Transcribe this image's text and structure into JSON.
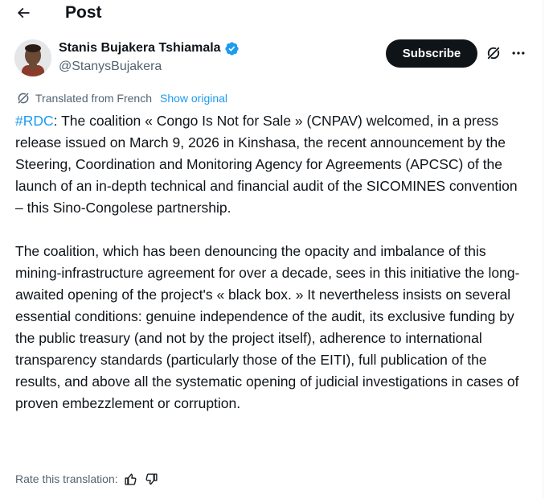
{
  "header": {
    "title": "Post"
  },
  "author": {
    "name": "Stanis Bujakera Tshiamala",
    "handle": "@StanysBujakera",
    "verified": true
  },
  "actions": {
    "subscribe_label": "Subscribe"
  },
  "translation": {
    "label": "Translated from French",
    "show_original": "Show original"
  },
  "post": {
    "hashtag": "#RDC",
    "paragraph1_text": ": The coalition « Congo Is Not for Sale » (CNPAV) welcomed, in a press release issued on March 9, 2026 in Kinshasa, the recent announcement by the Steering, Coordination and Monitoring Agency for Agreements (APCSC) of the launch of an in-depth technical and financial audit of the SICOMINES convention – this Sino-Congolese partnership.",
    "paragraph2": "The coalition, which has been denouncing the opacity and imbalance of this mining-infrastructure agreement for over a decade, sees in this initiative the long-awaited opening of the project's « black box. » It nevertheless insists on several essential conditions: genuine independence of the audit, its exclusive funding by the public treasury (and not by the project itself), adherence to international transparency standards (particularly those of the EITI), full publication of the results, and above all the systematic opening of judicial investigations in cases of proven embezzlement or corruption."
  },
  "rating": {
    "label": "Rate this translation:"
  },
  "colors": {
    "accent": "#1d9bf0",
    "text": "#0f1419",
    "secondary_text": "#536471",
    "button_bg": "#0f1419"
  }
}
